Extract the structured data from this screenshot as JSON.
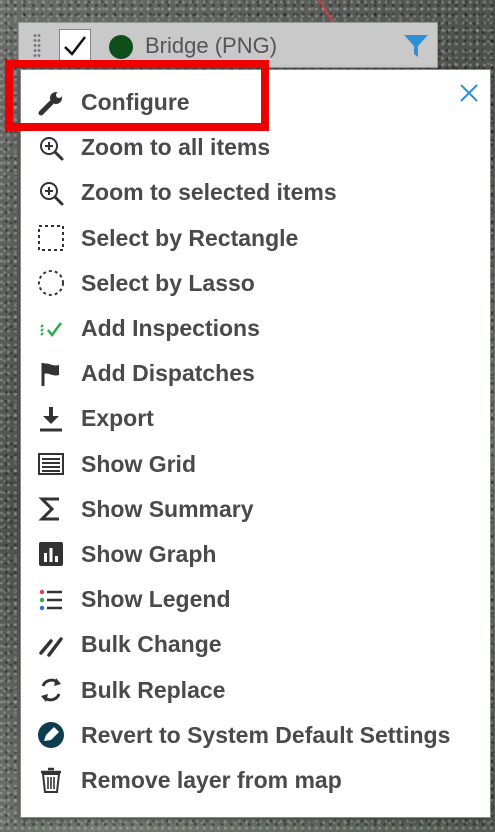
{
  "layer": {
    "name": "Bridge (PNG)",
    "checked": true,
    "color": "#0f4d1b",
    "icons": [
      "drag-handle-icon",
      "checkmark-icon",
      "filter-icon"
    ]
  },
  "menu": {
    "close_icon": "close-icon",
    "items": [
      {
        "label": "Configure",
        "icon": "wrench-icon"
      },
      {
        "label": "Zoom to all items",
        "icon": "zoom-in-icon"
      },
      {
        "label": "Zoom to selected items",
        "icon": "zoom-in-icon"
      },
      {
        "label": "Select by Rectangle",
        "icon": "rectangle-select-icon"
      },
      {
        "label": "Select by Lasso",
        "icon": "lasso-select-icon"
      },
      {
        "label": "Add Inspections",
        "icon": "inspections-icon"
      },
      {
        "label": "Add Dispatches",
        "icon": "flag-icon"
      },
      {
        "label": "Export",
        "icon": "download-icon"
      },
      {
        "label": "Show Grid",
        "icon": "grid-icon"
      },
      {
        "label": "Show Summary",
        "icon": "sigma-icon"
      },
      {
        "label": "Show Graph",
        "icon": "bar-chart-icon"
      },
      {
        "label": "Show Legend",
        "icon": "legend-icon"
      },
      {
        "label": "Bulk Change",
        "icon": "pencil-icon"
      },
      {
        "label": "Bulk Replace",
        "icon": "replace-icon"
      },
      {
        "label": "Revert to System Default Settings",
        "icon": "revert-icon"
      },
      {
        "label": "Remove layer from map",
        "icon": "trash-icon"
      }
    ]
  },
  "colors": {
    "highlight": "#ee0000",
    "filter": "#2f8fd8",
    "inspections": "#2eaa4a",
    "revert": "#0d3d4f"
  }
}
